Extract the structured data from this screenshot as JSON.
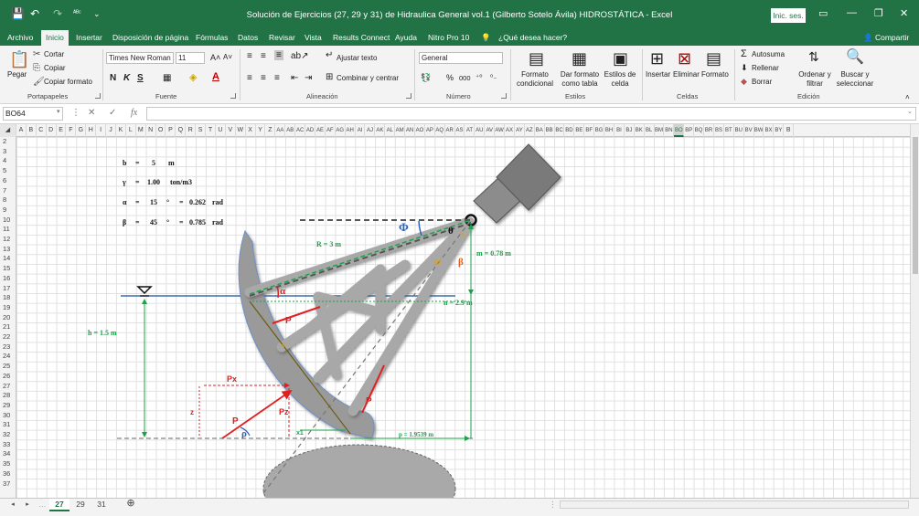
{
  "window": {
    "title": "Solución de Ejercicios (27, 29 y 31) de Hidraulica General  vol.1 (Gilberto Sotelo Ávila) HIDROSTÁTICA  -  Excel",
    "signin_label": "Inic. ses."
  },
  "quick_access": {
    "save": "💾",
    "undo": "↶",
    "redo": "↷",
    "spell": "ᴬᴮᶜ"
  },
  "tabs": [
    {
      "label": "Archivo",
      "active": false
    },
    {
      "label": "Inicio",
      "active": true
    },
    {
      "label": "Insertar",
      "active": false
    },
    {
      "label": "Disposición de página",
      "active": false
    },
    {
      "label": "Fórmulas",
      "active": false
    },
    {
      "label": "Datos",
      "active": false
    },
    {
      "label": "Revisar",
      "active": false
    },
    {
      "label": "Vista",
      "active": false
    },
    {
      "label": "Results Connect",
      "active": false
    },
    {
      "label": "Ayuda",
      "active": false
    },
    {
      "label": "Nitro Pro 10",
      "active": false
    },
    {
      "label": "¿Qué desea hacer?",
      "active": false
    }
  ],
  "share_label": "Compartir",
  "ribbon": {
    "clipboard": {
      "paste": "Pegar",
      "cut": "Cortar",
      "copy": "Copiar",
      "format_painter": "Copiar formato",
      "group": "Portapapeles"
    },
    "font": {
      "name": "Times New Roman",
      "size": "11",
      "bold": "N",
      "italic": "K",
      "underline": "S",
      "group": "Fuente"
    },
    "alignment": {
      "wrap": "Ajustar texto",
      "merge": "Combinar y centrar",
      "group": "Alineación"
    },
    "number": {
      "format": "General",
      "percent": "%",
      "thousands": "000",
      "group": "Número"
    },
    "styles": {
      "conditional": "Formato condicional",
      "as_table": "Dar formato como tabla",
      "cell_styles": "Estilos de celda",
      "group": "Estilos"
    },
    "cells": {
      "insert": "Insertar",
      "delete": "Eliminar",
      "format": "Formato",
      "group": "Celdas"
    },
    "editing": {
      "autosum": "Autosuma",
      "fill": "Rellenar",
      "clear": "Borrar",
      "sort": "Ordenar y filtrar",
      "find": "Buscar y seleccionar",
      "group": "Edición"
    }
  },
  "formula_bar": {
    "name_box": "BO64",
    "formula": ""
  },
  "columns": [
    "A",
    "B",
    "C",
    "D",
    "E",
    "F",
    "G",
    "H",
    "I",
    "J",
    "K",
    "L",
    "M",
    "N",
    "O",
    "P",
    "Q",
    "R",
    "S",
    "T",
    "U",
    "V",
    "W",
    "X",
    "Y",
    "Z",
    "AA",
    "AB",
    "AC",
    "AD",
    "AE",
    "AF",
    "AG",
    "AH",
    "AI",
    "AJ",
    "AK",
    "AL",
    "AM",
    "AN",
    "AO",
    "AP",
    "AQ",
    "AR",
    "AS",
    "AT",
    "AU",
    "AV",
    "AW",
    "AX",
    "AY",
    "AZ",
    "BA",
    "BB",
    "BC",
    "BD",
    "BE",
    "BF",
    "BG",
    "BH",
    "BI",
    "BJ",
    "BK",
    "BL",
    "BM",
    "BN",
    "BO",
    "BP",
    "BQ",
    "BR",
    "BS",
    "BT",
    "BU",
    "BV",
    "BW",
    "BX",
    "BY",
    "B"
  ],
  "selected_column": "BO",
  "rows": [
    "2",
    "3",
    "4",
    "5",
    "6",
    "7",
    "8",
    "9",
    "10",
    "11",
    "12",
    "13",
    "14",
    "15",
    "16",
    "17",
    "18",
    "19",
    "20",
    "21",
    "22",
    "23",
    "24",
    "25",
    "26",
    "27",
    "28",
    "29",
    "30",
    "31",
    "32",
    "33",
    "34",
    "35",
    "36",
    "37"
  ],
  "parameters": {
    "b": {
      "sym": "b",
      "eq": "=",
      "val": "5",
      "unit": "m"
    },
    "gamma": {
      "sym": "γ",
      "eq": "=",
      "val": "1.00",
      "unit": "ton/m3"
    },
    "alpha": {
      "sym": "α",
      "eq": "=",
      "val": "15",
      "deg": "°",
      "eq2": "=",
      "rad": "0.262",
      "unit": "rad"
    },
    "beta": {
      "sym": "β",
      "eq": "=",
      "val": "45",
      "deg": "°",
      "eq2": "=",
      "rad": "0.785",
      "unit": "rad"
    }
  },
  "diagram_labels": {
    "R": "R  =    3     m",
    "m": "m  =  0.78   m",
    "n": "n  =  2.9     m",
    "h": "h  =   1.5    m",
    "p": "p  =     1.9539      m",
    "phi": "Φ",
    "theta": "θ",
    "omega": "ω",
    "beta": "β",
    "alpha": "α",
    "a": "a",
    "P": "P",
    "Px": "Px",
    "Pz": "Pz",
    "z": "z",
    "x1": "x1",
    "rho": "ρ"
  },
  "colors": {
    "excel_green": "#217346",
    "dim_green": "#1aa34a",
    "force_red": "#e02020",
    "arm_blue": "#2d63b8",
    "truss": "#a8a8a8"
  },
  "sheet_tabs": [
    {
      "label": "27",
      "active": true
    },
    {
      "label": "29",
      "active": false
    },
    {
      "label": "31",
      "active": false
    }
  ],
  "add_sheet_icon": "⊕"
}
